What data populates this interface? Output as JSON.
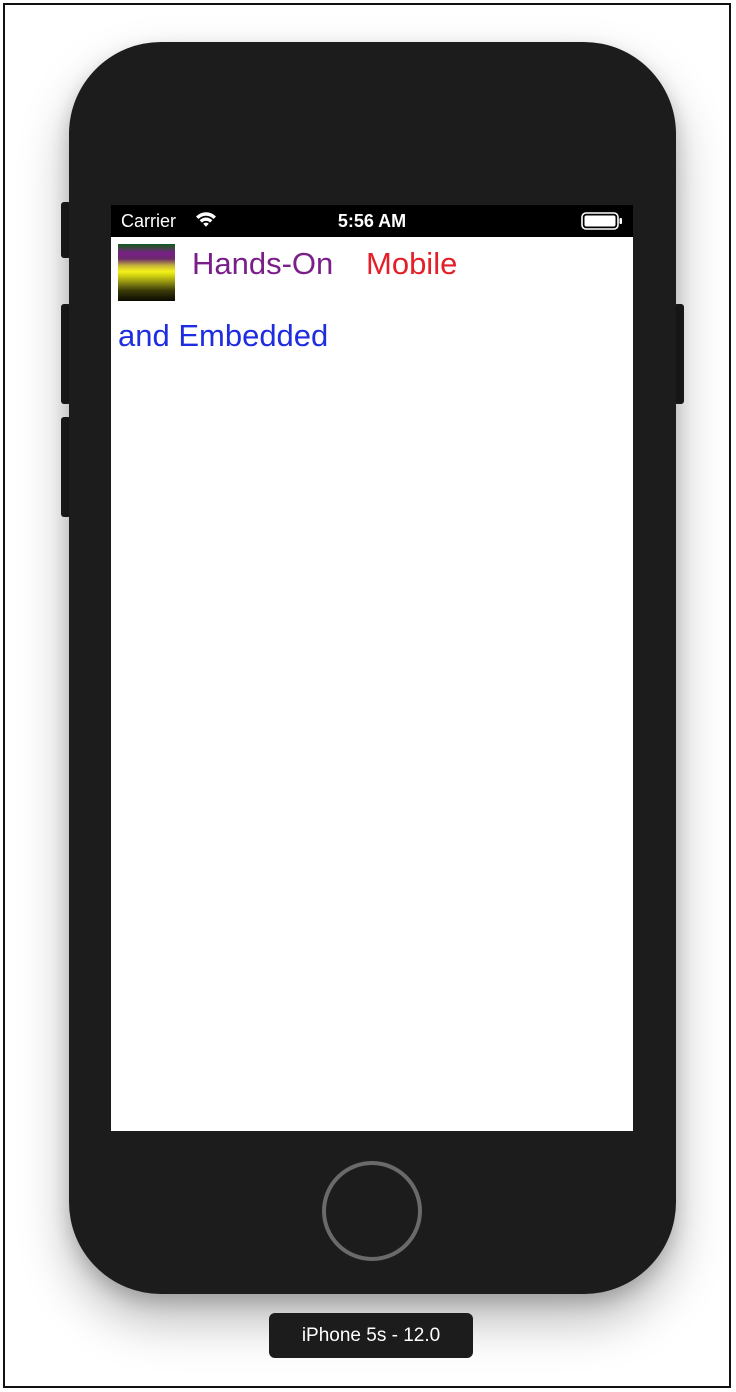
{
  "status_bar": {
    "carrier": "Carrier",
    "time": "5:56 AM",
    "wifi_icon": "wifi-icon",
    "battery_icon": "battery-full-icon"
  },
  "app": {
    "line1_word1": "Hands-On",
    "line1_word2": "Mobile",
    "line2": "and Embedded",
    "colors": {
      "hands_on": "#7a1f8a",
      "mobile": "#e3202a",
      "embedded": "#1f2de0"
    },
    "image_icon": "gradient-stripes-image"
  },
  "simulator": {
    "device_label": "iPhone 5s - 12.0",
    "home_button_icon": "home-button"
  }
}
